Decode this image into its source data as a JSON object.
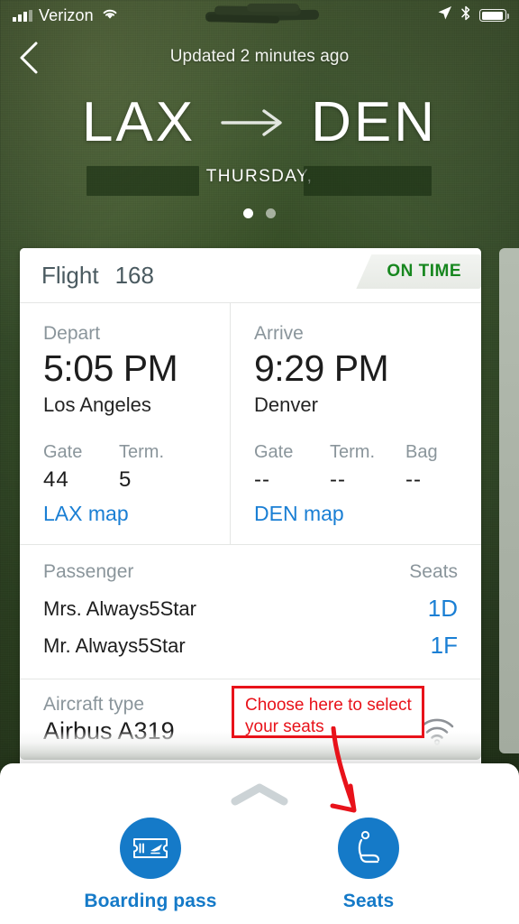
{
  "status_bar": {
    "carrier": "Verizon",
    "signal_icon": "signal-bars-icon",
    "wifi_icon": "wifi-icon",
    "location_icon": "location-arrow-icon",
    "bluetooth_icon": "bluetooth-icon",
    "battery_icon": "battery-icon",
    "clock_redacted": true
  },
  "nav": {
    "back_icon": "chevron-left-icon",
    "updated_text": "Updated 2 minutes ago"
  },
  "route": {
    "origin_code": "LAX",
    "arrow_icon": "arrow-right-icon",
    "destination_code": "DEN",
    "date_text": "THURSDAY,",
    "date_redacted": true,
    "page_dots": 2,
    "active_dot_index": 0
  },
  "flight_card": {
    "flight_label": "Flight",
    "flight_number": "168",
    "status": "ON TIME",
    "status_color": "#17871f",
    "depart": {
      "label": "Depart",
      "time": "5:05 PM",
      "city": "Los Angeles",
      "meta": [
        {
          "head": "Gate",
          "value": "44"
        },
        {
          "head": "Term.",
          "value": "5"
        }
      ],
      "map_link": "LAX map"
    },
    "arrive": {
      "label": "Arrive",
      "time": "9:29 PM",
      "city": "Denver",
      "meta": [
        {
          "head": "Gate",
          "value": "--"
        },
        {
          "head": "Term.",
          "value": "--"
        },
        {
          "head": "Bag",
          "value": "--"
        }
      ],
      "map_link": "DEN map"
    },
    "passengers": {
      "col_passenger": "Passenger",
      "col_seats": "Seats",
      "rows": [
        {
          "name": "Mrs. Always5Star",
          "seat": "1D"
        },
        {
          "name": "Mr. Always5Star",
          "seat": "1F"
        }
      ]
    },
    "aircraft": {
      "label": "Aircraft type",
      "value": "Airbus A319",
      "wifi_icon": "wifi-available-icon"
    }
  },
  "annotation": {
    "text": "Choose here to select your seats",
    "color": "#e8121a",
    "arrow_icon": "curved-arrow-icon"
  },
  "bottom_sheet": {
    "handle_icon": "chevron-up-icon",
    "accent_color": "#157ac8",
    "actions": [
      {
        "label": "Boarding pass",
        "icon": "boarding-pass-icon"
      },
      {
        "label": "Seats",
        "icon": "seat-icon"
      }
    ]
  }
}
